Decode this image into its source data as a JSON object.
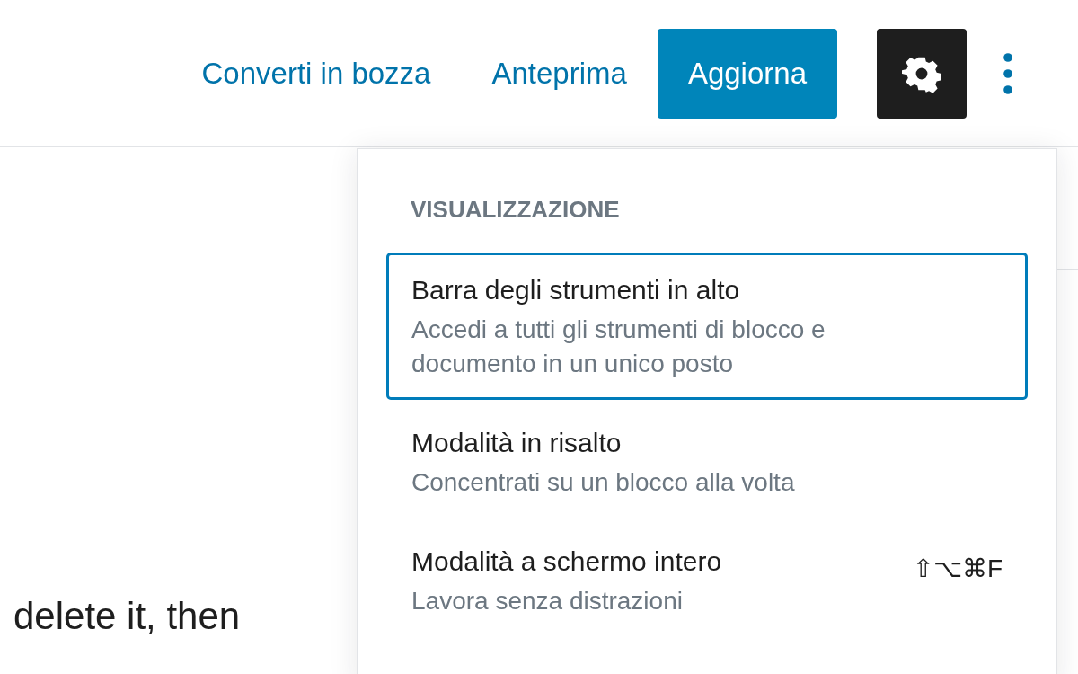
{
  "toolbar": {
    "links": [
      "Converti in bozza",
      "Anteprima"
    ],
    "primary_button": "Aggiorna",
    "settings_selected": true
  },
  "content": {
    "text": "delete it, then"
  },
  "menu": {
    "heading": "VISUALIZZAZIONE",
    "items": [
      {
        "label": "Barra degli strumenti in alto",
        "description": "Accedi a tutti gli strumenti di blocco e documento in un unico posto",
        "selected": true
      },
      {
        "label": "Modalità in risalto",
        "description": "Concentrati su un blocco alla volta",
        "selected": false
      },
      {
        "label": "Modalità a schermo intero",
        "description": "Lavora senza distrazioni",
        "shortcut": "⇧⌥⌘F",
        "selected": false
      }
    ]
  }
}
